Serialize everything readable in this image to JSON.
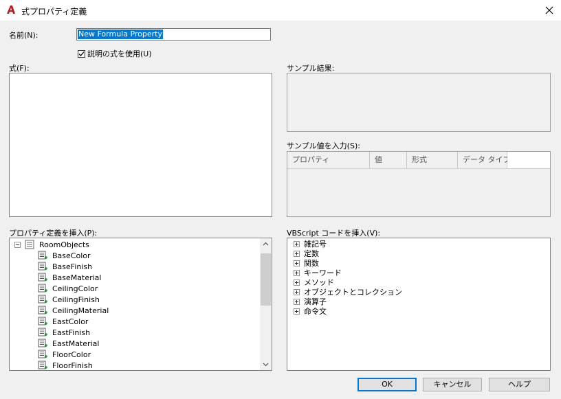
{
  "window": {
    "title": "式プロパティ定義",
    "close_icon": "close-icon"
  },
  "name_field": {
    "label": "名前(N):",
    "value": "New Formula Property"
  },
  "use_formula_description": {
    "label": "説明の式を使用(U)",
    "checked": true
  },
  "formula": {
    "label": "式(F):",
    "value": ""
  },
  "sample_result": {
    "label": "サンプル結果:",
    "value": ""
  },
  "sample_values": {
    "label": "サンプル値を入力(S):",
    "columns": [
      "プロパティ",
      "値",
      "形式",
      "データ タイプ"
    ]
  },
  "property_definitions": {
    "label": "プロパティ定義を挿入(P):",
    "root": "RoomObjects",
    "items": [
      "BaseColor",
      "BaseFinish",
      "BaseMaterial",
      "CeilingColor",
      "CeilingFinish",
      "CeilingMaterial",
      "EastColor",
      "EastFinish",
      "EastMaterial",
      "FloorColor",
      "FloorFinish"
    ]
  },
  "vbscript": {
    "label": "VBScript コードを挿入(V):",
    "items": [
      "雑記号",
      "定数",
      "関数",
      "キーワード",
      "メソッド",
      "オブジェクトとコレクション",
      "演算子",
      "命令文"
    ]
  },
  "buttons": {
    "ok": "OK",
    "cancel": "キャンセル",
    "help": "ヘルプ"
  },
  "colors": {
    "accent": "#0078d7",
    "app_icon": "#c3161c"
  }
}
